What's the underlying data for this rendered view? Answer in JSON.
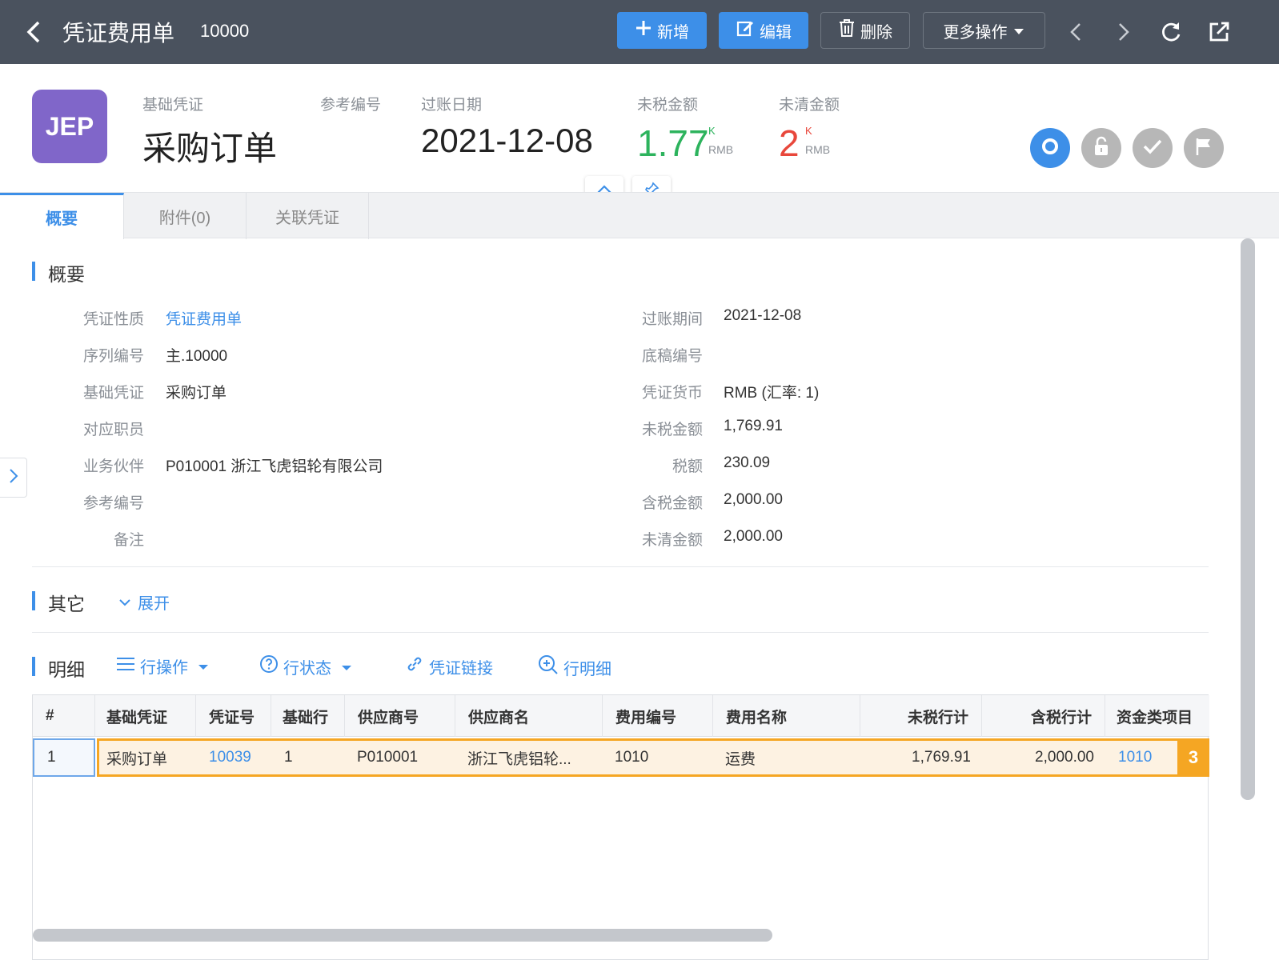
{
  "topbar": {
    "title": "凭证费用单",
    "doc_number": "10000",
    "buttons": {
      "new": "新增",
      "edit": "编辑",
      "delete": "删除",
      "more": "更多操作"
    }
  },
  "header": {
    "logo_text": "JEP",
    "base_doc_label": "基础凭证",
    "base_doc_value": "采购订单",
    "ref_label": "参考编号",
    "post_date_label": "过账日期",
    "post_date_value": "2021-12-08",
    "pretax_label": "未税金额",
    "pretax_value": "1.77",
    "pretax_unit": "K",
    "pretax_currency": "RMB",
    "open_label": "未清金额",
    "open_value": "2",
    "open_unit": "K",
    "open_currency": "RMB",
    "colors": {
      "pretax": "#2db35d",
      "open": "#e8473b",
      "logo": "#8066c9"
    }
  },
  "tabs": [
    "概要",
    "附件(0)",
    "关联凭证"
  ],
  "summary": {
    "title": "概要",
    "left": [
      {
        "label": "凭证性质",
        "value": "凭证费用单"
      },
      {
        "label": "序列编号",
        "value": "主.10000"
      },
      {
        "label": "基础凭证",
        "value": "采购订单"
      },
      {
        "label": "对应职员",
        "value": ""
      },
      {
        "label": "业务伙伴",
        "value": "P010001 浙江飞虎铝轮有限公司"
      },
      {
        "label": "参考编号",
        "value": ""
      },
      {
        "label": "备注",
        "value": ""
      }
    ],
    "right": [
      {
        "label": "过账期间",
        "value": "2021-12-08"
      },
      {
        "label": "底稿编号",
        "value": ""
      },
      {
        "label": "凭证货币",
        "value": "RMB (汇率: 1)"
      },
      {
        "label": "未税金额",
        "value": "1,769.91"
      },
      {
        "label": "税额",
        "value": "230.09"
      },
      {
        "label": "含税金额",
        "value": "2,000.00"
      },
      {
        "label": "未清金额",
        "value": "2,000.00"
      }
    ]
  },
  "other": {
    "title": "其它",
    "expand": "展开"
  },
  "detail": {
    "title": "明细",
    "tools": [
      "行操作",
      "行状态",
      "凭证链接",
      "行明细"
    ],
    "columns": [
      "#",
      "基础凭证",
      "凭证号",
      "基础行",
      "供应商号",
      "供应商名",
      "费用编号",
      "费用名称",
      "未税行计",
      "含税行计",
      "资金类项目"
    ],
    "rows": [
      [
        "1",
        "采购订单",
        "10039",
        "1",
        "P010001",
        "浙江飞虎铝轮...",
        "1010",
        "运费",
        "1,769.91",
        "2,000.00",
        "1010"
      ]
    ],
    "row_badge": "3"
  }
}
